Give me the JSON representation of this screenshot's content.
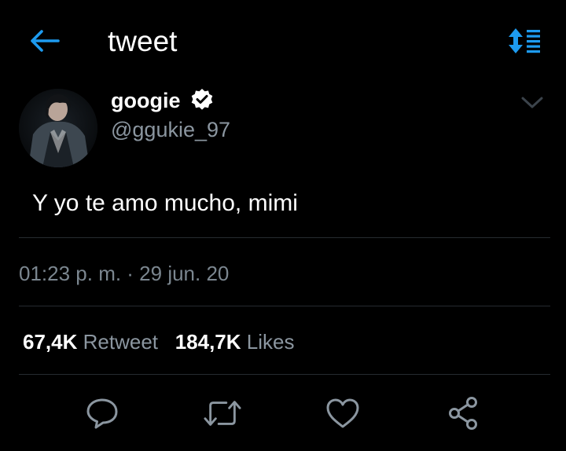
{
  "header": {
    "title": "tweet",
    "back_icon": "arrow-left-icon",
    "sort_icon": "sort-toggle-icon",
    "accent_color": "#1d9bf0"
  },
  "tweet": {
    "author_name": "googie",
    "author_handle": "@ggukie_97",
    "verified": true,
    "text": "Y yo te amo mucho, mimi",
    "timestamp": "01:23 p. m. · 29 jun. 20"
  },
  "stats": {
    "retweets_count": "67,4K",
    "retweets_label": "Retweet",
    "likes_count": "184,7K",
    "likes_label": "Likes"
  },
  "actions": [
    {
      "name": "reply",
      "icon": "comment-icon"
    },
    {
      "name": "retweet",
      "icon": "retweet-icon"
    },
    {
      "name": "like",
      "icon": "heart-icon"
    },
    {
      "name": "share",
      "icon": "share-icon"
    }
  ],
  "colors": {
    "background": "#000000",
    "primary_text": "#ffffff",
    "secondary_text": "#8b96a0",
    "divider": "#262b30"
  }
}
